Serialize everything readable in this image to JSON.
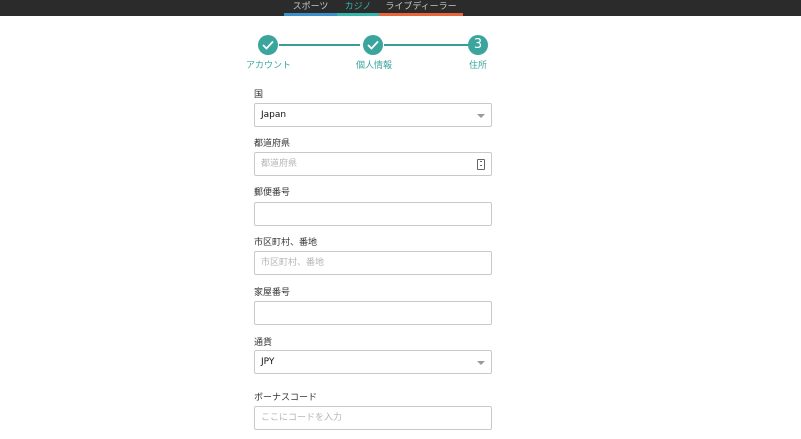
{
  "nav": {
    "tabs": [
      {
        "label": "スポーツ",
        "underline": "#3a8fc6"
      },
      {
        "label": "カジノ",
        "underline": "#35b4aa",
        "active": true
      },
      {
        "label": "ライブディーラー",
        "underline": "#e8643c"
      }
    ]
  },
  "steps": {
    "items": [
      {
        "label": "アカウント",
        "state": "completed",
        "icon": "check-icon"
      },
      {
        "label": "個人情報",
        "state": "completed",
        "icon": "check-icon"
      },
      {
        "label": "住所",
        "state": "current",
        "number": "3"
      }
    ],
    "accent_color": "#3aa59c"
  },
  "form": {
    "country": {
      "label": "国",
      "value": "Japan"
    },
    "prefecture": {
      "label": "都道府県",
      "placeholder": "都道府県"
    },
    "postal_code": {
      "label": "郵便番号",
      "value": ""
    },
    "city": {
      "label": "市区町村、番地",
      "placeholder": "市区町村、番地"
    },
    "house_number": {
      "label": "家屋番号",
      "value": ""
    },
    "currency": {
      "label": "通貨",
      "value": "JPY"
    },
    "bonus_code": {
      "label": "ボーナスコード",
      "placeholder": "ここにコードを入力"
    }
  }
}
